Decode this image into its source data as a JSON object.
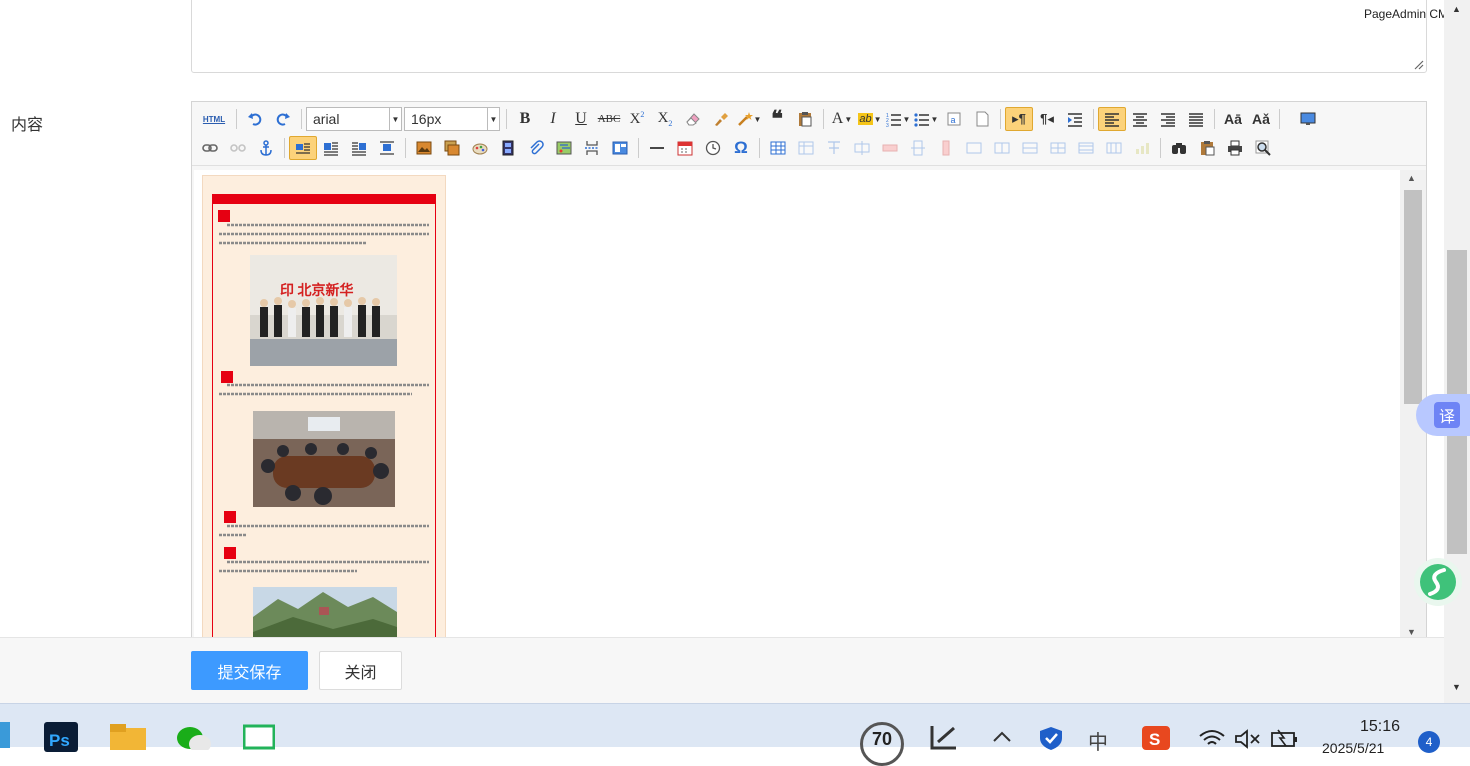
{
  "app": {
    "brand": "PageAdmin CMS"
  },
  "form": {
    "content_label": "内容"
  },
  "toolbar": {
    "html_label": "HTML",
    "font_family": "arial",
    "font_size": "16px"
  },
  "buttons": {
    "submit": "提交保存",
    "close": "关闭"
  },
  "floating": {
    "translate": "译"
  },
  "taskbar": {
    "badge_70": "70",
    "ime": "中",
    "time": "15:16",
    "date": "2025/5/21",
    "notifications": "4"
  },
  "colors": {
    "primary": "#3d9aff",
    "accent_red": "#e60012",
    "toolbar_active": "#fcd27a"
  }
}
